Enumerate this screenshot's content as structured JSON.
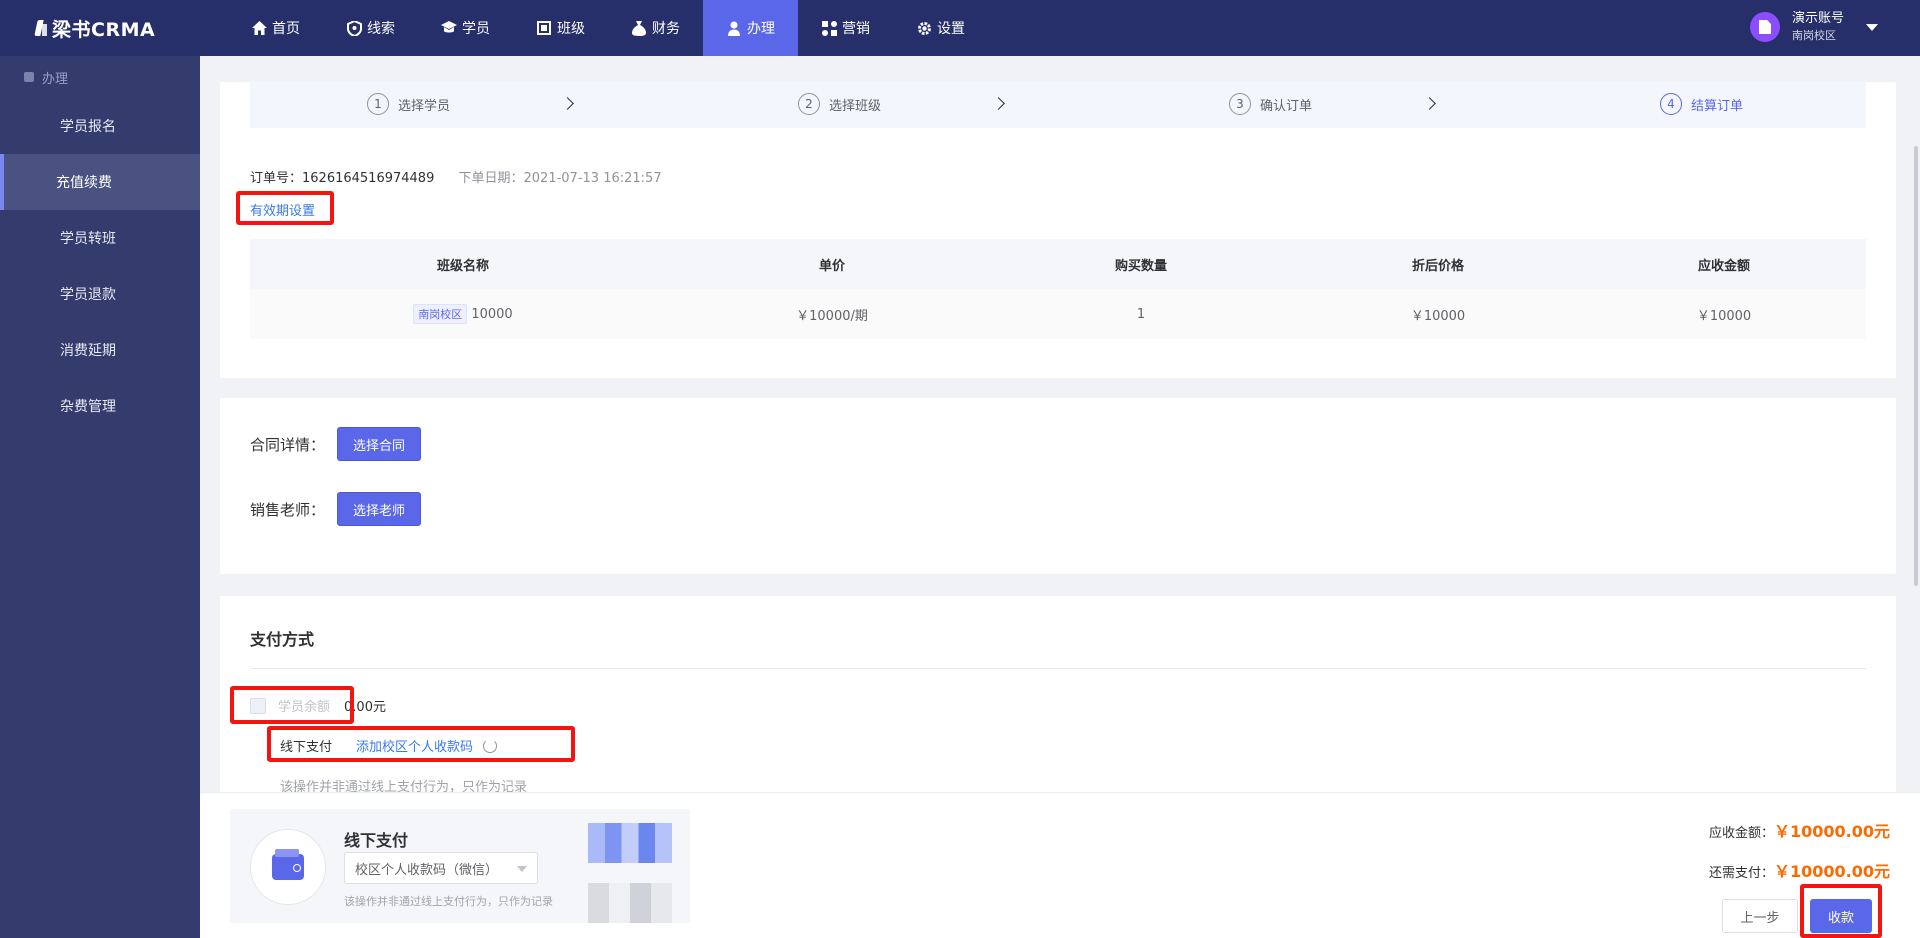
{
  "app": {
    "brand": "梁书CRMA"
  },
  "nav": {
    "items": [
      {
        "label": "首页",
        "icon": "home-icon"
      },
      {
        "label": "线索",
        "icon": "lead-icon"
      },
      {
        "label": "学员",
        "icon": "student-icon"
      },
      {
        "label": "班级",
        "icon": "class-icon"
      },
      {
        "label": "财务",
        "icon": "finance-icon"
      },
      {
        "label": "办理",
        "icon": "handle-icon",
        "active": true
      },
      {
        "label": "营销",
        "icon": "marketing-icon"
      },
      {
        "label": "设置",
        "icon": "settings-icon"
      }
    ]
  },
  "user": {
    "name": "演示账号",
    "campus": "南岗校区"
  },
  "sidebar": {
    "group": "办理",
    "items": [
      {
        "label": "学员报名"
      },
      {
        "label": "充值续费",
        "active": true
      },
      {
        "label": "学员转班"
      },
      {
        "label": "学员退款"
      },
      {
        "label": "消费延期"
      },
      {
        "label": "杂费管理"
      }
    ]
  },
  "steps": [
    {
      "num": "1",
      "label": "选择学员"
    },
    {
      "num": "2",
      "label": "选择班级"
    },
    {
      "num": "3",
      "label": "确认订单"
    },
    {
      "num": "4",
      "label": "结算订单",
      "current": true
    }
  ],
  "order": {
    "number_label": "订单号：",
    "number": "1626164516974489",
    "date_label": "下单日期：",
    "date": "2021-07-13 16:21:57",
    "validity_link": "有效期设置"
  },
  "table": {
    "headers": [
      "班级名称",
      "单价",
      "购买数量",
      "折后价格",
      "应收金额"
    ],
    "row": {
      "campus_tag": "南岗校区",
      "class_name": "10000",
      "unit_price": "￥10000/期",
      "quantity": "1",
      "discounted": "￥10000",
      "receivable": "￥10000"
    }
  },
  "contract": {
    "label": "合同详情：",
    "button": "选择合同"
  },
  "sales": {
    "label": "销售老师：",
    "button": "选择老师"
  },
  "payment": {
    "title": "支付方式",
    "balance_label": "学员余额",
    "balance_amount": "0.00元",
    "offline_label": "线下支付",
    "add_code_link": "添加校区个人收款码",
    "note": "该操作并非通过线上支付行为，只作为记录"
  },
  "footer": {
    "card_title": "线下支付",
    "select_value": "校区个人收款码（微信）",
    "card_note": "该操作并非通过线上支付行为，只作为记录",
    "receivable_label": "应收金额：",
    "receivable_value": "￥10000.00元",
    "due_label": "还需支付：",
    "due_value": "￥10000.00元",
    "prev_button": "上一步",
    "collect_button": "收款"
  },
  "colors": {
    "primary": "#5a67e8",
    "nav_bg": "#262f6a",
    "sidebar_bg": "#343c6e",
    "highlight": "#f5140f",
    "amount": "#ff6a00"
  }
}
